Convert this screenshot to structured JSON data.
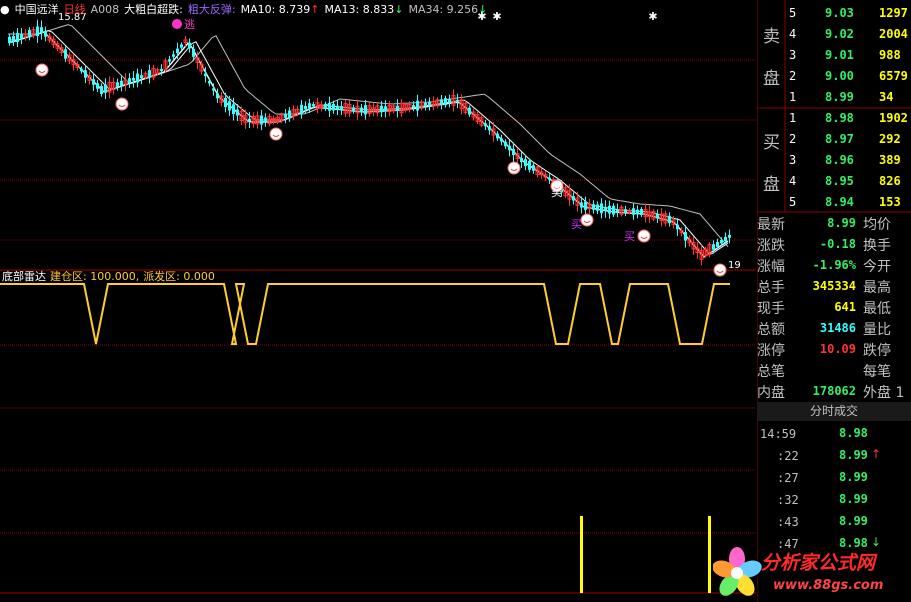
{
  "colors": {
    "background": "#000000",
    "up": "#ff3333",
    "down": "#33ffff",
    "grid": "#8b0000",
    "indicator": "#ffcc33",
    "stat_green": "#33ee66",
    "stat_red": "#ff3333",
    "volume_yellow": "#ffff00",
    "ma10": "#ffffff",
    "ma13": "#ffffff",
    "ma34": "#c0c0c0"
  },
  "header": {
    "stock_name": "中国远洋",
    "period": "日线",
    "code": "A008",
    "formula1": "大粗白超跌:",
    "formula2": "粗大反弹:",
    "ma10_label": "MA10: 8.739",
    "ma10_arrow": "↑",
    "ma13_label": "MA13: 8.833",
    "ma13_arrow": "↓",
    "ma34_label": "MA34: 9.256",
    "ma34_arrow": "↓"
  },
  "main_chart": {
    "high_label": "15.87",
    "low_label": "19",
    "escape_label": "逃",
    "buy_label": "买",
    "buy_label2": "买",
    "buy_label3": "买"
  },
  "indicator": {
    "title": "底部雷达",
    "build_label": "建仓区: 100.000,",
    "sell_label": "派发区: 0.000"
  },
  "chart_data": {
    "type": "line",
    "series": [
      {
        "name": "建仓区",
        "values_by_region": [
          {
            "from": 0,
            "to": 90,
            "value": 100
          },
          {
            "from": 90,
            "to": 102,
            "value": 0
          },
          {
            "from": 102,
            "to": 230,
            "value": 100
          },
          {
            "from": 230,
            "to": 238,
            "value": 0
          },
          {
            "from": 238,
            "to": 242,
            "value": 100
          },
          {
            "from": 242,
            "to": 262,
            "value": 0
          },
          {
            "from": 262,
            "to": 550,
            "value": 100
          },
          {
            "from": 550,
            "to": 574,
            "value": 0
          },
          {
            "from": 574,
            "to": 606,
            "value": 100
          },
          {
            "from": 606,
            "to": 624,
            "value": 0
          },
          {
            "from": 624,
            "to": 674,
            "value": 100
          },
          {
            "from": 674,
            "to": 708,
            "value": 0
          },
          {
            "from": 708,
            "to": 730,
            "value": 100
          }
        ]
      }
    ]
  },
  "order_book": {
    "sell_char1": "卖",
    "sell_char2": "盘",
    "buy_char1": "买",
    "buy_char2": "盘",
    "sells": [
      {
        "level": "5",
        "price": "9.03",
        "vol": "1297"
      },
      {
        "level": "4",
        "price": "9.02",
        "vol": "2004"
      },
      {
        "level": "3",
        "price": "9.01",
        "vol": "988"
      },
      {
        "level": "2",
        "price": "9.00",
        "vol": "6579"
      },
      {
        "level": "1",
        "price": "8.99",
        "vol": "34"
      }
    ],
    "buys": [
      {
        "level": "1",
        "price": "8.98",
        "vol": "1902"
      },
      {
        "level": "2",
        "price": "8.97",
        "vol": "292"
      },
      {
        "level": "3",
        "price": "8.96",
        "vol": "389"
      },
      {
        "level": "4",
        "price": "8.95",
        "vol": "826"
      },
      {
        "level": "5",
        "price": "8.94",
        "vol": "153"
      }
    ]
  },
  "stats": [
    {
      "k": "最新",
      "v": "8.99",
      "color": "green",
      "k2": "均价"
    },
    {
      "k": "涨跌",
      "v": "-0.18",
      "color": "green",
      "k2": "换手"
    },
    {
      "k": "涨幅",
      "v": "-1.96%",
      "color": "green",
      "k2": "今开"
    },
    {
      "k": "总手",
      "v": "345334",
      "color": "yellow",
      "k2": "最高"
    },
    {
      "k": "现手",
      "v": "641",
      "color": "yellow",
      "k2": "最低"
    },
    {
      "k": "总额",
      "v": "31486",
      "color": "cyan",
      "k2": "量比"
    },
    {
      "k": "涨停",
      "v": "10.09",
      "color": "red",
      "k2": "跌停"
    },
    {
      "k": "总笔",
      "v": "",
      "color": "yellow",
      "k2": "每笔"
    },
    {
      "k": "内盘",
      "v": "178062",
      "color": "green",
      "k2": "外盘 1"
    }
  ],
  "ticks": {
    "title": "分时成交",
    "rows": [
      {
        "time": "14:59",
        "price": "8.98",
        "arrow": ""
      },
      {
        "time": ":22",
        "price": "8.99",
        "arrow": "↑"
      },
      {
        "time": ":27",
        "price": "8.99",
        "arrow": ""
      },
      {
        "time": ":32",
        "price": "8.99",
        "arrow": ""
      },
      {
        "time": ":43",
        "price": "8.99",
        "arrow": ""
      },
      {
        "time": ":47",
        "price": "8.98",
        "arrow": "↓"
      }
    ]
  },
  "logo": {
    "name": "分析家公式网",
    "url": "www.88gs.com"
  }
}
